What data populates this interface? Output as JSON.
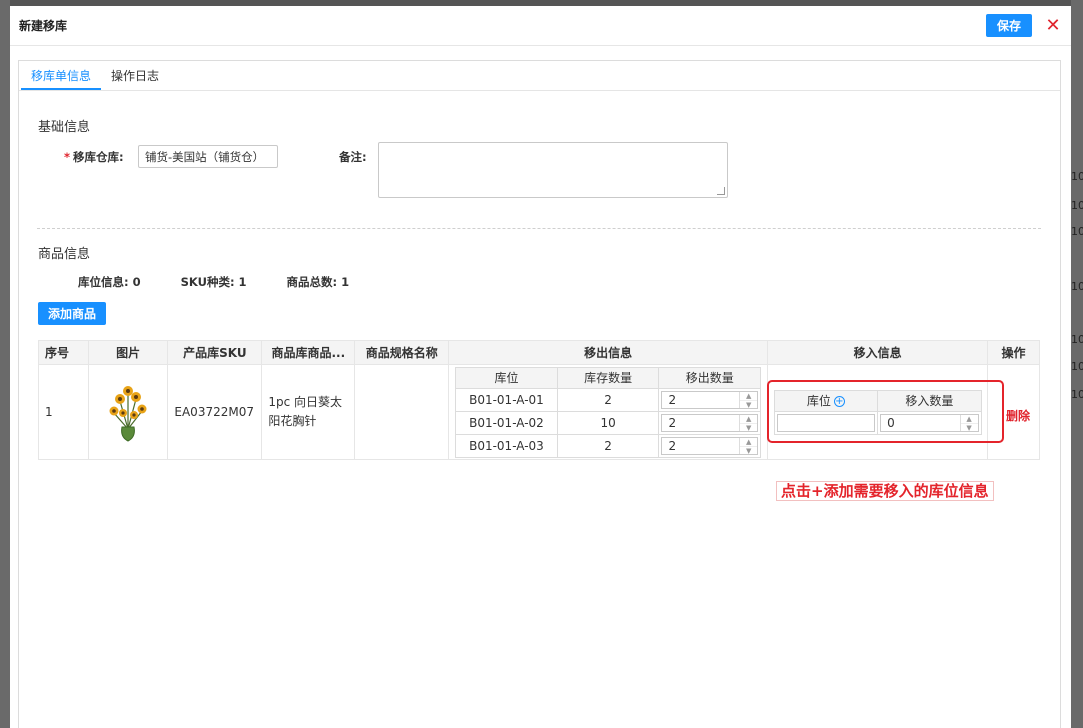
{
  "modal": {
    "title": "新建移库",
    "save_label": "保存",
    "close_glyph": "✕"
  },
  "tabs": [
    {
      "label": "移库单信息",
      "active": true
    },
    {
      "label": "操作日志",
      "active": false
    }
  ],
  "basic_info": {
    "section_title": "基础信息",
    "warehouse_label": "移库仓库:",
    "warehouse_value": "铺货-美国站（铺货仓）",
    "remark_label": "备注:",
    "remark_value": ""
  },
  "product_info": {
    "section_title": "商品信息",
    "stats": {
      "location_info": "库位信息: 0",
      "sku_types": "SKU种类: 1",
      "total_items": "商品总数: 1"
    },
    "add_button": "添加商品"
  },
  "table": {
    "headers": [
      "序号",
      "图片",
      "产品库SKU",
      "商品库商品...",
      "商品规格名称",
      "移出信息",
      "移入信息",
      "操作"
    ],
    "row": {
      "index": "1",
      "sku": "EA03722M07",
      "product_name": "1pc 向日葵太阳花胸针",
      "spec_name": "",
      "delete_label": "删除",
      "move_out": {
        "headers": [
          "库位",
          "库存数量",
          "移出数量"
        ],
        "rows": [
          {
            "location": "B01-01-A-01",
            "stock": "2",
            "qty": "2"
          },
          {
            "location": "B01-01-A-02",
            "stock": "10",
            "qty": "2"
          },
          {
            "location": "B01-01-A-03",
            "stock": "2",
            "qty": "2"
          }
        ]
      },
      "move_in": {
        "headers": [
          "库位",
          "移入数量"
        ],
        "rows": [
          {
            "location": "",
            "qty": "0"
          }
        ]
      }
    }
  },
  "annotation": "点击+添加需要移入的库位信息",
  "backdrop_numbers": [
    "10",
    "10",
    "10",
    "10",
    "10",
    "10",
    "10"
  ],
  "colors": {
    "primary": "#1890ff",
    "danger": "#e0242d",
    "highlight": "#e4242b"
  }
}
